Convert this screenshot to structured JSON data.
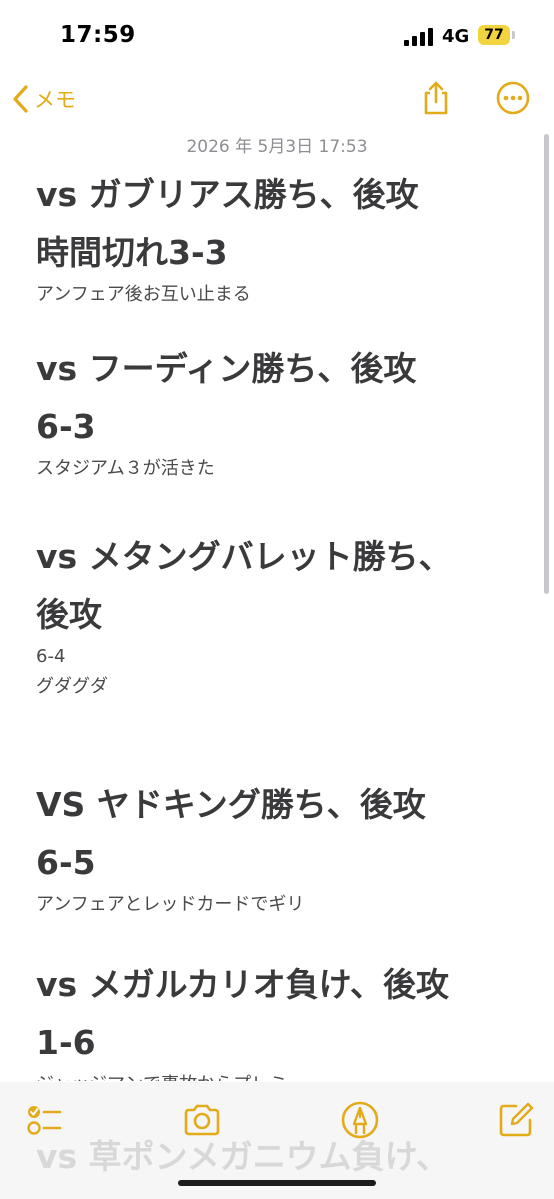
{
  "status_bar": {
    "time": "17:59",
    "network": "4G",
    "battery": "77"
  },
  "nav": {
    "back_label": "メモ"
  },
  "note": {
    "date": "2026 年 5月3日 17:53",
    "blocks": [
      {
        "title_lines": [
          "vs ガブリアス勝ち、後攻",
          "時間切れ3-3"
        ],
        "body_lines": [
          "アンフェア後お互い止まる"
        ]
      },
      {
        "title_lines": [
          "vs フーディン勝ち、後攻",
          "6-3"
        ],
        "body_lines": [
          "スタジアム３が活きた"
        ]
      },
      {
        "title_lines": [
          "vs メタングバレット勝ち、",
          "後攻"
        ],
        "body_lines": [
          "6-4",
          "グダグダ"
        ]
      },
      {
        "title_lines": [
          "VS ヤドキング勝ち、後攻",
          "6-5"
        ],
        "body_lines": [
          "アンフェアとレッドカードでギリ"
        ]
      },
      {
        "title_lines": [
          "vs メガルカリオ負け、後攻",
          "1-6"
        ],
        "body_lines": [
          "ジャッジマンで事故からプレミ"
        ]
      }
    ],
    "ghost_line": "vs 草ポンメガニウム負け、"
  },
  "toolbar": {
    "checklist_icon": "checklist-icon",
    "camera_icon": "camera-icon",
    "markup_icon": "markup-pen-icon",
    "compose_icon": "compose-icon"
  },
  "colors": {
    "accent": "#e3aa1a",
    "battery": "#f2d43e",
    "title": "#3a3a3c"
  }
}
